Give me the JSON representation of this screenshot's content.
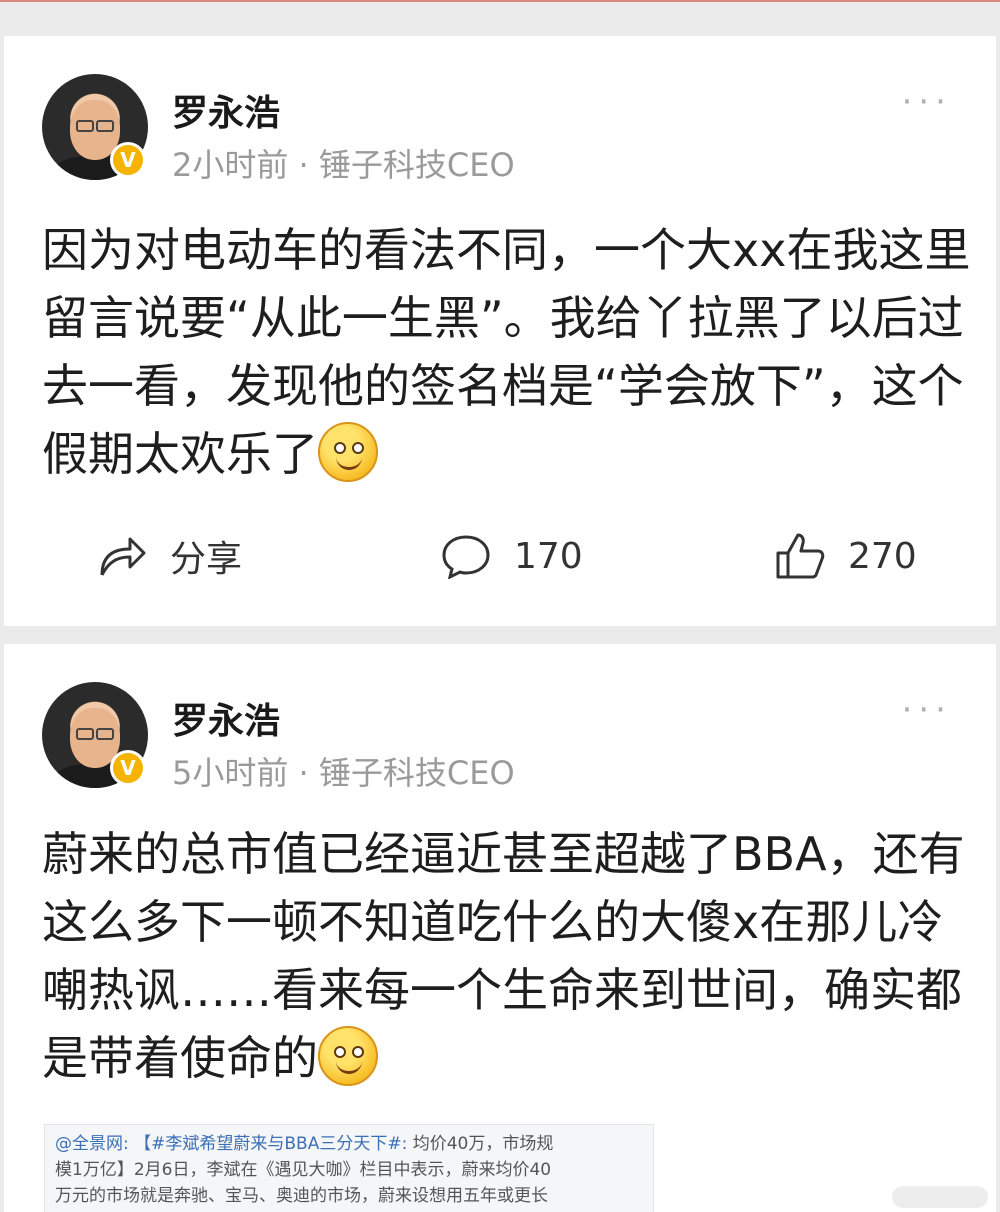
{
  "colors": {
    "page_bg": "#ebebeb",
    "card_bg": "#ffffff",
    "name": "#1a1a1a",
    "meta": "#9a9a9a",
    "verified_badge": "#f6b400",
    "link_blue": "#3b6fb6"
  },
  "posts": [
    {
      "author": "罗永浩",
      "meta": "2小时前 · 锤子科技CEO",
      "verified_badge": "V",
      "text": "因为对电动车的看法不同，一个大xx在我这里留言说要“从此一生黑”。我给丫拉黑了以后过去一看，发现他的签名档是“学会放下”，这个假期太欢乐了",
      "emoji": "grin-emoji",
      "actions": {
        "share_label": "分享",
        "comment_count": "170",
        "like_count": "270"
      }
    },
    {
      "author": "罗永浩",
      "meta": "5小时前 · 锤子科技CEO",
      "verified_badge": "V",
      "text": "蔚来的总市值已经逼近甚至超越了BBA，还有这么多下一顿不知道吃什么的大傻x在那儿冷嘲热讽……看来每一个生命来到世间，确实都是带着使命的",
      "emoji": "smile-emoji",
      "quote": {
        "user": "@全景网:",
        "topic": "【#李斌希望蔚来与BBA三分天下#:",
        "line1_rest": "均价40万，市场规",
        "line2": "模1万亿】2月6日，李斌在《遇见大咖》栏目中表示，蔚来均价40",
        "line3": "万元的市场就是奔驰、宝马、奥迪的市场，蔚来设想用五年或更长"
      }
    }
  ],
  "icons": {
    "more": "more-dots-icon",
    "share": "share-arrow-icon",
    "comment": "comment-bubble-icon",
    "like": "thumbs-up-icon"
  }
}
